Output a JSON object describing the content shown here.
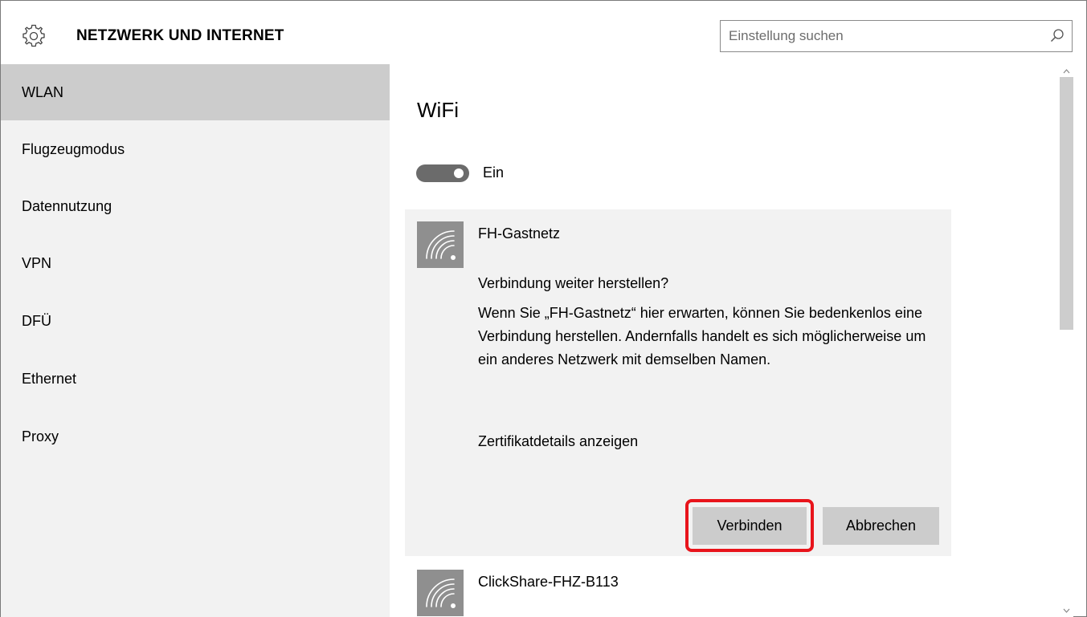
{
  "header": {
    "title": "NETZWERK UND INTERNET",
    "icon": "gear-icon"
  },
  "search": {
    "placeholder": "Einstellung suchen",
    "value": "",
    "icon": "search-icon"
  },
  "sidebar": {
    "items": [
      {
        "label": "WLAN",
        "selected": true
      },
      {
        "label": "Flugzeugmodus",
        "selected": false
      },
      {
        "label": "Datennutzung",
        "selected": false
      },
      {
        "label": "VPN",
        "selected": false
      },
      {
        "label": "DFÜ",
        "selected": false
      },
      {
        "label": "Ethernet",
        "selected": false
      },
      {
        "label": "Proxy",
        "selected": false
      }
    ]
  },
  "main": {
    "heading": "WiFi",
    "wifi_toggle": {
      "state": "on",
      "label": "Ein"
    },
    "networks": [
      {
        "name": "FH-Gastnetz",
        "icon": "wifi-signal-icon",
        "expanded": true,
        "question": "Verbindung weiter herstellen?",
        "description": "Wenn Sie „FH-Gastnetz“ hier erwarten, können Sie bedenkenlos eine Verbindung herstellen. Andernfalls handelt es sich möglicherweise um ein anderes Netzwerk mit demselben Namen.",
        "cert_link": "Zertifikatdetails anzeigen",
        "connect_label": "Verbinden",
        "cancel_label": "Abbrechen"
      },
      {
        "name": "ClickShare-FHZ-B113",
        "icon": "wifi-signal-icon",
        "expanded": false
      }
    ]
  },
  "colors": {
    "sidebar_bg": "#f2f2f2",
    "sidebar_selected": "#cccccc",
    "card_bg": "#f2f2f2",
    "button_bg": "#cccccc",
    "toggle_on": "#6b6b6b",
    "highlight_annotation": "#e8141b",
    "wifi_tile": "#8f8f8f"
  }
}
